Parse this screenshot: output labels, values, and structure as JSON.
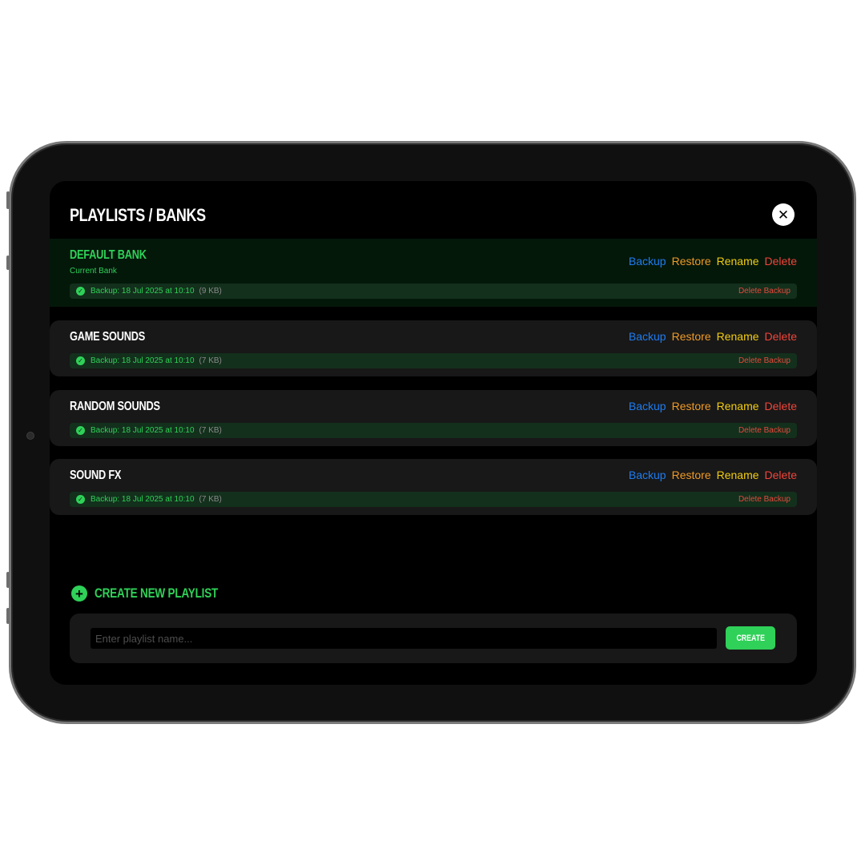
{
  "header": {
    "title": "PLAYLISTS / BANKS",
    "close_glyph": "✕"
  },
  "actions": {
    "backup": "Backup",
    "restore": "Restore",
    "rename": "Rename",
    "delete": "Delete"
  },
  "delete_backup_label": "Delete Backup",
  "banks": [
    {
      "name": "DEFAULT BANK",
      "subtitle": "Current Bank",
      "backup": "Backup: 18 Jul 2025 at 10:10",
      "size": "(9 KB)"
    },
    {
      "name": "GAME SOUNDS",
      "backup": "Backup: 18 Jul 2025 at 10:10",
      "size": "(7 KB)"
    },
    {
      "name": "RANDOM SOUNDS",
      "backup": "Backup: 18 Jul 2025 at 10:10",
      "size": "(7 KB)"
    },
    {
      "name": "SOUND FX",
      "backup": "Backup: 18 Jul 2025 at 10:10",
      "size": "(7 KB)"
    }
  ],
  "create": {
    "heading": "CREATE NEW PLAYLIST",
    "placeholder": "Enter playlist name...",
    "button": "CREATE"
  },
  "icons": {
    "plus": "+",
    "check": "✓"
  },
  "colors": {
    "accent_green": "#2fd158",
    "backup_blue": "#1e7cf0",
    "restore_orange": "#f09a26",
    "rename_yellow": "#f2cd12",
    "delete_red": "#f0453a"
  }
}
